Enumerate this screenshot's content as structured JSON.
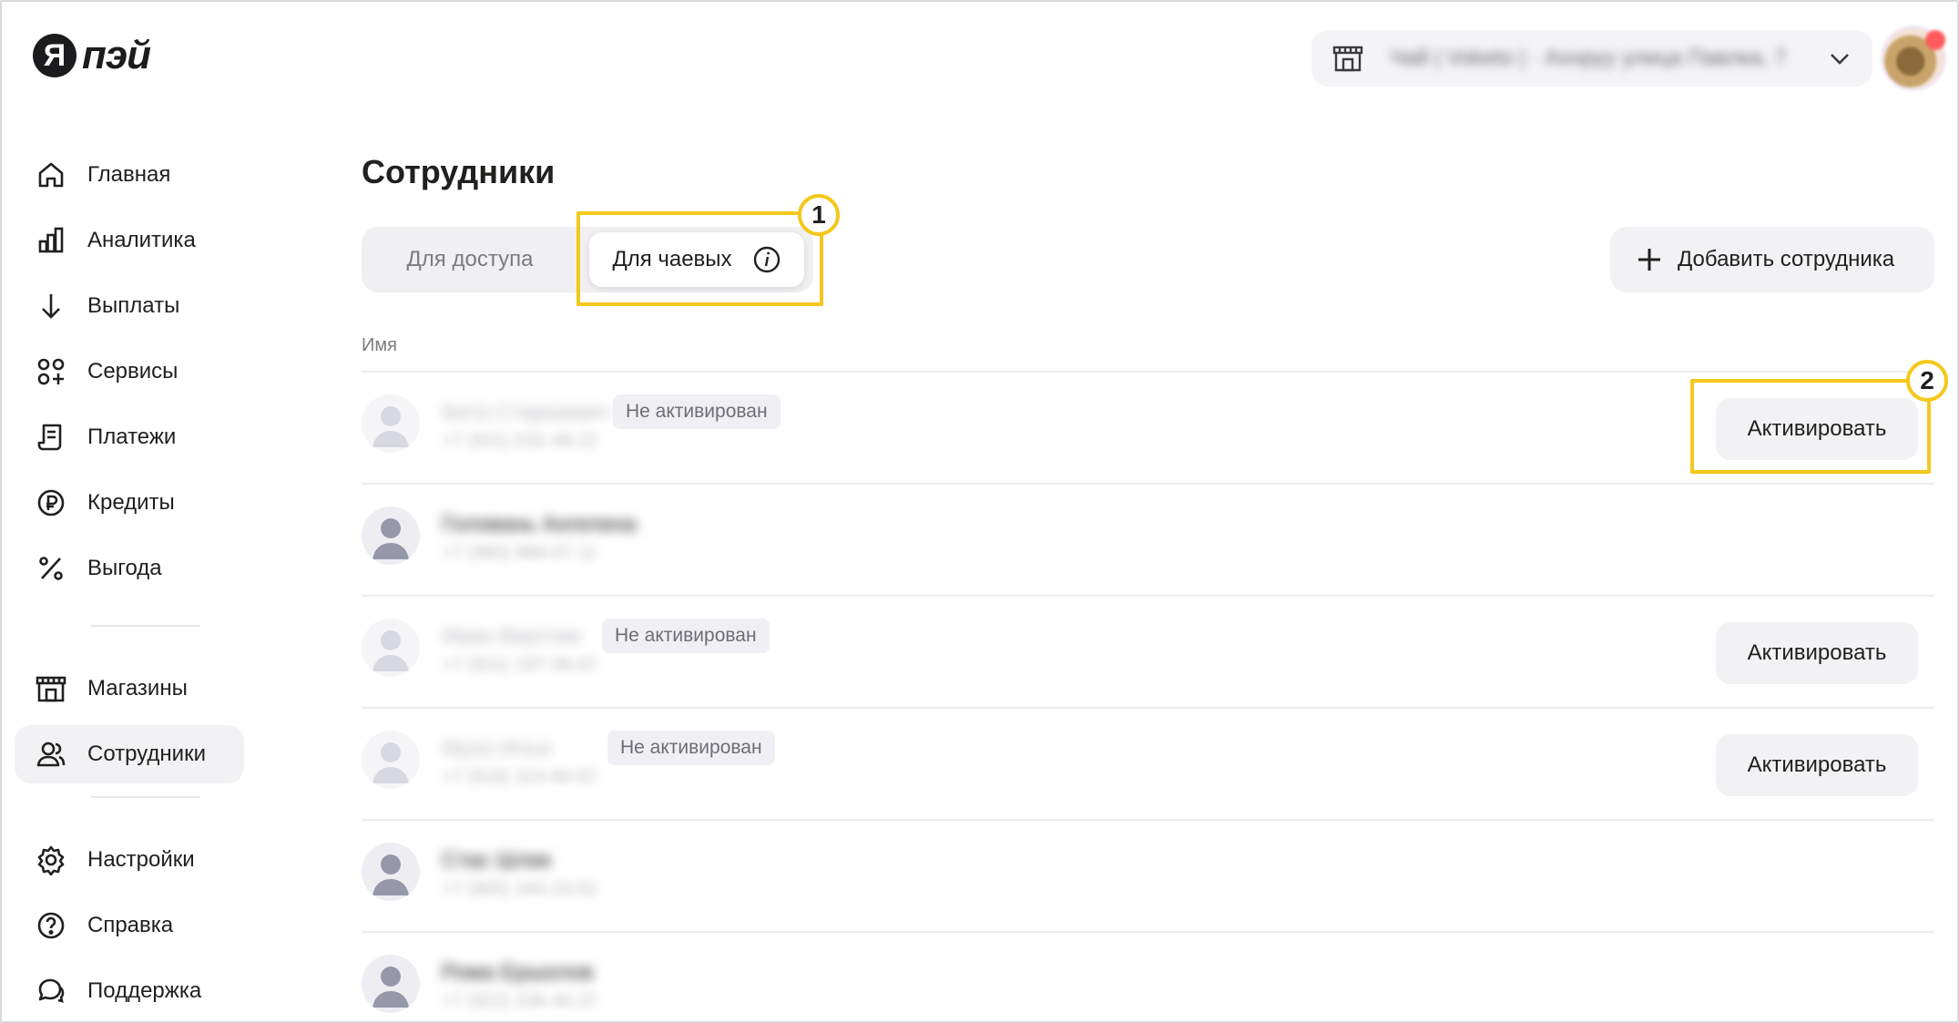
{
  "app": {
    "logo_letter": "Я",
    "logo_word": "пэй"
  },
  "header": {
    "store_selector_text": "Чай | Voketo | · Ахнруу улица Павлка, 7",
    "store_icon": "store-icon",
    "chevron_icon": "chevron-down-icon"
  },
  "sidebar": {
    "items": [
      {
        "label": "Главная",
        "icon": "home-icon"
      },
      {
        "label": "Аналитика",
        "icon": "chart-icon"
      },
      {
        "label": "Выплаты",
        "icon": "arrow-down-icon"
      },
      {
        "label": "Сервисы",
        "icon": "services-icon"
      },
      {
        "label": "Платежи",
        "icon": "receipt-icon"
      },
      {
        "label": "Кредиты",
        "icon": "ruble-icon"
      },
      {
        "label": "Выгода",
        "icon": "percent-icon"
      },
      {
        "label": "Магазины",
        "icon": "store-icon"
      },
      {
        "label": "Сотрудники",
        "icon": "people-icon",
        "active": true
      },
      {
        "label": "Настройки",
        "icon": "gear-icon"
      },
      {
        "label": "Справка",
        "icon": "help-icon"
      },
      {
        "label": "Поддержка",
        "icon": "chat-icon"
      }
    ]
  },
  "main": {
    "title": "Сотрудники",
    "tabs": [
      {
        "label": "Для доступа",
        "active": false
      },
      {
        "label": "Для чаевых",
        "active": true
      }
    ],
    "add_button_label": "Добавить сотрудника",
    "column_header": "Имя",
    "annotations": [
      "1",
      "2"
    ],
    "accent_color": "#f4c81c",
    "employees": [
      {
        "name": "Бета Старшевич",
        "phone": "+7 (931) 032-48-22",
        "status": "Не активирован",
        "action": "Активировать",
        "active": false
      },
      {
        "name": "Головань Ангелина",
        "phone": "+7 (960) 968-07-11",
        "status": "",
        "action": "",
        "active": true
      },
      {
        "name": "Иван Вертлик",
        "phone": "+7 (921) 197-06-07",
        "status": "Не активирован",
        "action": "Активировать",
        "active": false
      },
      {
        "name": "Мухо Илья",
        "phone": "+7 (916) 324-60-57",
        "status": "Не активирован",
        "action": "Активировать",
        "active": false
      },
      {
        "name": "Стас Шлик",
        "phone": "+7 (905) 340-23-52",
        "status": "",
        "action": "",
        "active": true
      },
      {
        "name": "Рома Ершолов",
        "phone": "+7 (922) 236-40-37",
        "status": "",
        "action": "",
        "active": true
      }
    ]
  }
}
